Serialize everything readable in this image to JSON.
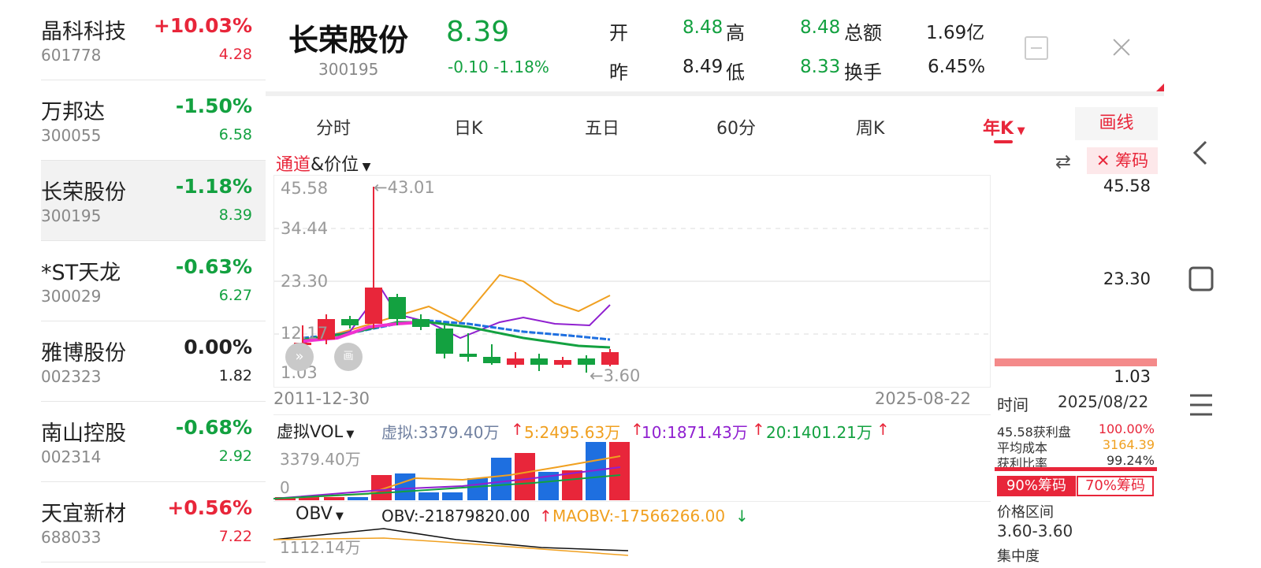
{
  "watchlist": [
    {
      "name": "晶科科技",
      "code": "601778",
      "pct": "+10.03%",
      "price": "4.28",
      "dir": "up"
    },
    {
      "name": "万邦达",
      "code": "300055",
      "pct": "-1.50%",
      "price": "6.58",
      "dir": "down"
    },
    {
      "name": "长荣股份",
      "code": "300195",
      "pct": "-1.18%",
      "price": "8.39",
      "dir": "down",
      "active": true
    },
    {
      "name": "*ST天龙",
      "code": "300029",
      "pct": "-0.63%",
      "price": "6.27",
      "dir": "down"
    },
    {
      "name": "雅博股份",
      "code": "002323",
      "pct": "0.00%",
      "price": "1.82",
      "dir": "flat"
    },
    {
      "name": "南山控股",
      "code": "002314",
      "pct": "-0.68%",
      "price": "2.92",
      "dir": "down"
    },
    {
      "name": "天宜新材",
      "code": "688033",
      "pct": "+0.56%",
      "price": "7.22",
      "dir": "up"
    }
  ],
  "header": {
    "name": "长荣股份",
    "code": "300195",
    "price": "8.39",
    "change": "-0.10 -1.18%",
    "open_label": "开",
    "open": "8.48",
    "high_label": "高",
    "high": "8.48",
    "amount_label": "总额",
    "amount": "1.69亿",
    "prev_label": "昨",
    "prev": "8.49",
    "low_label": "低",
    "low": "8.33",
    "turnover_label": "换手",
    "turnover": "6.45%"
  },
  "tabs": [
    "分时",
    "日K",
    "五日",
    "60分",
    "周K",
    "年K"
  ],
  "active_tab": "年K",
  "draw_label": "画线",
  "indicator_left_red": "通道",
  "indicator_left_rest": "&价位",
  "chips_label": "筹码",
  "kline": {
    "y_labels": [
      "45.58",
      "34.44",
      "23.30",
      "12.17",
      "1.03"
    ],
    "high_mark": "43.01",
    "low_mark": "3.60",
    "date_start": "2011-12-30",
    "date_end": "2025-08-22"
  },
  "volume": {
    "selector": "虚拟VOL",
    "v_main": "虚拟:3379.40万",
    "v5": "5:2495.63万",
    "v10": "10:1871.43万",
    "v20": "20:1401.21万",
    "axis_top": "3379.40万",
    "axis_zero": "0"
  },
  "obv": {
    "selector": "OBV",
    "value": "OBV:-21879820.00",
    "ma": "MAOBV:-17566266.00",
    "axis_top": "1112.14万"
  },
  "chip_panel": {
    "price_top": "45.58",
    "price_mid": "23.30",
    "price_low": "1.03",
    "time_label": "时间",
    "time_value": "2025/08/22",
    "profit_label": "45.58获利盘",
    "profit_value": "100.00%",
    "avg_cost_label": "平均成本",
    "avg_cost_value": "3164.39",
    "profit_ratio_label": "获利比率",
    "profit_ratio_value": "99.24%",
    "btn90": "90%筹码",
    "btn70": "70%筹码",
    "range_label": "价格区间",
    "range_value": "3.60-3.60",
    "concentration_label": "集中度"
  },
  "colors": {
    "up": "#e8263a",
    "down": "#13a140",
    "blue": "#1e6fe0",
    "orange": "#f0a020",
    "purple": "#9020d0",
    "magenta": "#f030d0"
  }
}
